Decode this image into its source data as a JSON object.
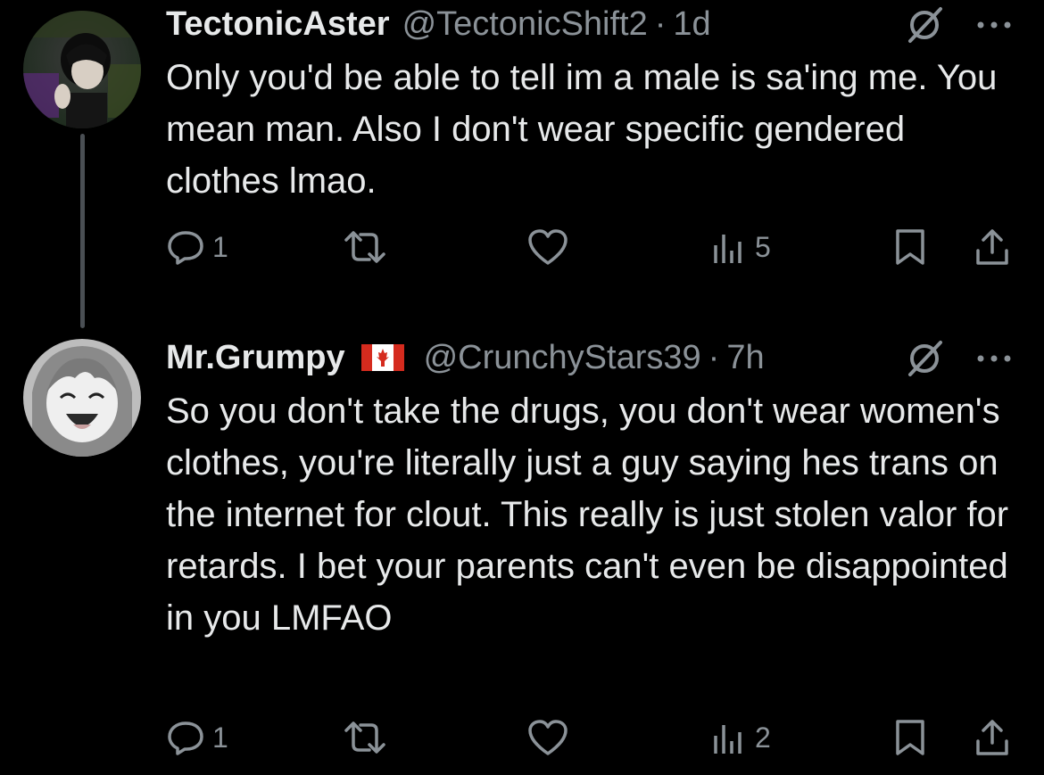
{
  "tweets": [
    {
      "display_name": "TectonicAster",
      "handle": "@TectonicShift2",
      "separator": "·",
      "time": "1d",
      "text": "Only you'd be able to tell im a male is sa'ing me. You mean man. Also I don't wear specific gendered clothes lmao.",
      "reply_count": "1",
      "views": "5",
      "avatar_icon": "profile-avatar-dark-haired-character"
    },
    {
      "display_name": "Mr.Grumpy",
      "flag_icon": "canada-flag-icon",
      "handle": "@CrunchyStars39",
      "separator": "·",
      "time": "7h",
      "text": "So you don't take the drugs, you don't wear women's clothes, you're literally just a guy saying hes trans on the internet for clout. This really is just stolen valor for retards. I bet your parents can't even be disappointed in you LMFAO",
      "reply_count": "1",
      "views": "2",
      "avatar_icon": "profile-avatar-anime-girl"
    }
  ],
  "icons": [
    "reply-icon",
    "retweet-icon",
    "like-icon",
    "views-icon",
    "bookmark-icon",
    "share-icon",
    "grok-icon",
    "more-icon"
  ],
  "colors": {
    "background": "#000000",
    "text": "#e7e9ea",
    "muted": "#8b9298"
  }
}
